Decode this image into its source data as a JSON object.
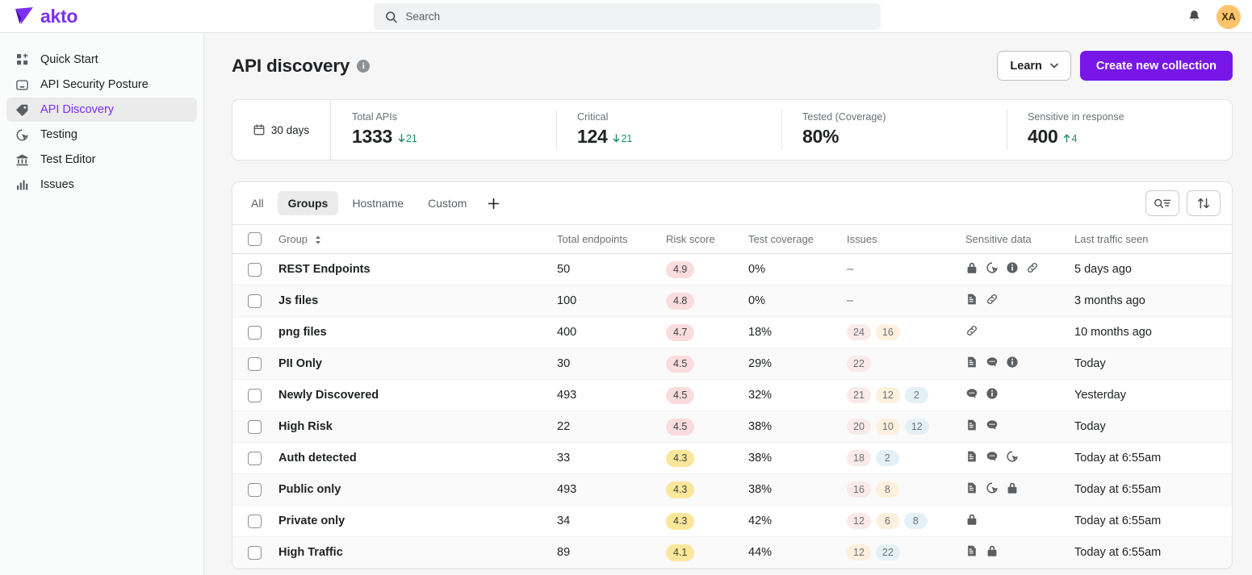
{
  "brand": {
    "name": "akto",
    "logo_icon": "paper-plane-icon",
    "color": "#7b2ff7"
  },
  "topbar": {
    "search_placeholder": "Search",
    "search_value": "",
    "search_icon": "search-icon",
    "notification_icon": "bell-icon",
    "avatar_initials": "XA",
    "avatar_color": "#ffc46b"
  },
  "sidebar": {
    "items": [
      {
        "label": "Quick Start",
        "icon": "grid-plus-icon",
        "active": false
      },
      {
        "label": "API Security Posture",
        "icon": "inbox-icon",
        "active": false
      },
      {
        "label": "API Discovery",
        "icon": "tag-icon",
        "active": true
      },
      {
        "label": "Testing",
        "icon": "cursor-target-icon",
        "active": false
      },
      {
        "label": "Test Editor",
        "icon": "bank-icon",
        "active": false
      },
      {
        "label": "Issues",
        "icon": "bar-chart-icon",
        "active": false
      }
    ]
  },
  "page": {
    "title": "API discovery",
    "info_icon": "info-icon",
    "learn_label": "Learn",
    "learn_chevron_icon": "chevron-down-icon",
    "create_label": "Create new collection",
    "primary_color": "#7716e8"
  },
  "stats": {
    "date_range": "30 days",
    "calendar_icon": "calendar-icon",
    "cards": [
      {
        "label": "Total APIs",
        "value": "1333",
        "delta": "21",
        "direction": "down"
      },
      {
        "label": "Critical",
        "value": "124",
        "delta": "21",
        "direction": "down"
      },
      {
        "label": "Tested (Coverage)",
        "value": "80%",
        "delta": "",
        "direction": ""
      },
      {
        "label": "Sensitive in response",
        "value": "400",
        "delta": "4",
        "direction": "up"
      }
    ],
    "delta_color": "#1a8f5e"
  },
  "table": {
    "tabs": [
      {
        "label": "All",
        "active": false
      },
      {
        "label": "Groups",
        "active": true
      },
      {
        "label": "Hostname",
        "active": false
      },
      {
        "label": "Custom",
        "active": false
      }
    ],
    "add_tab_icon": "plus-icon",
    "tools": [
      {
        "icon": "search-filter-icon",
        "name": "search-filter-button"
      },
      {
        "icon": "sort-arrows-icon",
        "name": "sort-button"
      }
    ],
    "columns": [
      "Group",
      "Total endpoints",
      "Risk score",
      "Test coverage",
      "Issues",
      "Sensitive data",
      "Last traffic seen"
    ],
    "sort_icon": "sort-updown-icon",
    "rows": [
      {
        "group": "REST Endpoints",
        "total_endpoints": "50",
        "risk_score": "4.9",
        "risk_level": "red",
        "test_coverage": "0%",
        "issues": [],
        "issues_empty": "–",
        "sensitive_icons": [
          "lock-icon",
          "cursor-target-icon",
          "info-icon",
          "link-icon"
        ],
        "last_traffic": "5 days ago"
      },
      {
        "group": "Js files",
        "total_endpoints": "100",
        "risk_score": "4.8",
        "risk_level": "red",
        "test_coverage": "0%",
        "issues": [],
        "issues_empty": "–",
        "sensitive_icons": [
          "document-icon",
          "link-icon"
        ],
        "last_traffic": "3 months ago"
      },
      {
        "group": "png files",
        "total_endpoints": "400",
        "risk_score": "4.7",
        "risk_level": "red",
        "test_coverage": "18%",
        "issues": [
          {
            "value": "24",
            "tone": "p-red"
          },
          {
            "value": "16",
            "tone": "p-orange"
          }
        ],
        "sensitive_icons": [
          "link-icon"
        ],
        "last_traffic": "10 months ago"
      },
      {
        "group": "PII Only",
        "total_endpoints": "30",
        "risk_score": "4.5",
        "risk_level": "red",
        "test_coverage": "29%",
        "issues": [
          {
            "value": "22",
            "tone": "p-red"
          }
        ],
        "sensitive_icons": [
          "document-icon",
          "chat-icon",
          "info-icon"
        ],
        "last_traffic": "Today"
      },
      {
        "group": "Newly Discovered",
        "total_endpoints": "493",
        "risk_score": "4.5",
        "risk_level": "red",
        "test_coverage": "32%",
        "issues": [
          {
            "value": "21",
            "tone": "p-red"
          },
          {
            "value": "12",
            "tone": "p-orange"
          },
          {
            "value": "2",
            "tone": "p-blue"
          }
        ],
        "sensitive_icons": [
          "chat-icon",
          "info-icon"
        ],
        "last_traffic": "Yesterday"
      },
      {
        "group": "High Risk",
        "total_endpoints": "22",
        "risk_score": "4.5",
        "risk_level": "red",
        "test_coverage": "38%",
        "issues": [
          {
            "value": "20",
            "tone": "p-red"
          },
          {
            "value": "10",
            "tone": "p-orange"
          },
          {
            "value": "12",
            "tone": "p-blue"
          }
        ],
        "sensitive_icons": [
          "document-icon",
          "chat-icon"
        ],
        "last_traffic": "Today"
      },
      {
        "group": "Auth detected",
        "total_endpoints": "33",
        "risk_score": "4.3",
        "risk_level": "yellow",
        "test_coverage": "38%",
        "issues": [
          {
            "value": "18",
            "tone": "p-red"
          },
          {
            "value": "2",
            "tone": "p-blue"
          }
        ],
        "sensitive_icons": [
          "document-icon",
          "chat-icon",
          "cursor-target-icon"
        ],
        "last_traffic": "Today at 6:55am"
      },
      {
        "group": "Public only",
        "total_endpoints": "493",
        "risk_score": "4.3",
        "risk_level": "yellow",
        "test_coverage": "38%",
        "issues": [
          {
            "value": "16",
            "tone": "p-red"
          },
          {
            "value": "8",
            "tone": "p-orange"
          }
        ],
        "sensitive_icons": [
          "document-icon",
          "cursor-target-icon",
          "lock-icon"
        ],
        "last_traffic": "Today at 6:55am"
      },
      {
        "group": "Private only",
        "total_endpoints": "34",
        "risk_score": "4.3",
        "risk_level": "yellow",
        "test_coverage": "42%",
        "issues": [
          {
            "value": "12",
            "tone": "p-red"
          },
          {
            "value": "6",
            "tone": "p-orange"
          },
          {
            "value": "8",
            "tone": "p-blue"
          }
        ],
        "sensitive_icons": [
          "lock-icon"
        ],
        "last_traffic": "Today at 6:55am"
      },
      {
        "group": "High Traffic",
        "total_endpoints": "89",
        "risk_score": "4.1",
        "risk_level": "yellow",
        "test_coverage": "44%",
        "issues": [
          {
            "value": "12",
            "tone": "p-orange"
          },
          {
            "value": "22",
            "tone": "p-blue"
          }
        ],
        "sensitive_icons": [
          "document-icon",
          "lock-icon"
        ],
        "last_traffic": "Today at 6:55am"
      }
    ]
  }
}
